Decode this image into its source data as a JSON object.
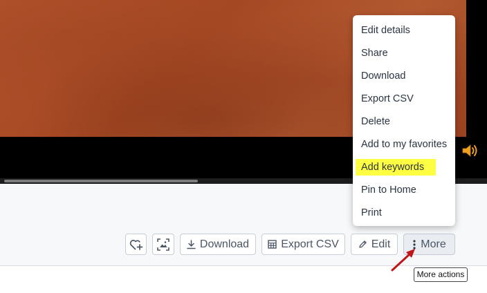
{
  "toolbar": {
    "download_label": "Download",
    "export_label": "Export CSV",
    "edit_label": "Edit",
    "more_label": "More"
  },
  "more_menu": {
    "items": [
      {
        "label": "Edit details"
      },
      {
        "label": "Share"
      },
      {
        "label": "Download"
      },
      {
        "label": "Export CSV"
      },
      {
        "label": "Delete"
      },
      {
        "label": "Add to my favorites"
      },
      {
        "label": "Add keywords",
        "highlighted": true
      },
      {
        "label": "Pin to Home"
      },
      {
        "label": "Print"
      }
    ]
  },
  "tooltip": {
    "text": "More actions"
  },
  "colors": {
    "highlight": "#ffff44",
    "annotation_arrow": "#c0151a",
    "speaker_icon": "#f0a020",
    "media_background": "#000000"
  },
  "icons": {
    "favorite": "heart-plus-icon",
    "image": "image-frame-icon",
    "download": "download-icon",
    "export": "table-grid-icon",
    "edit": "pencil-icon",
    "more": "vertical-dots-icon",
    "audio": "speaker-icon"
  }
}
